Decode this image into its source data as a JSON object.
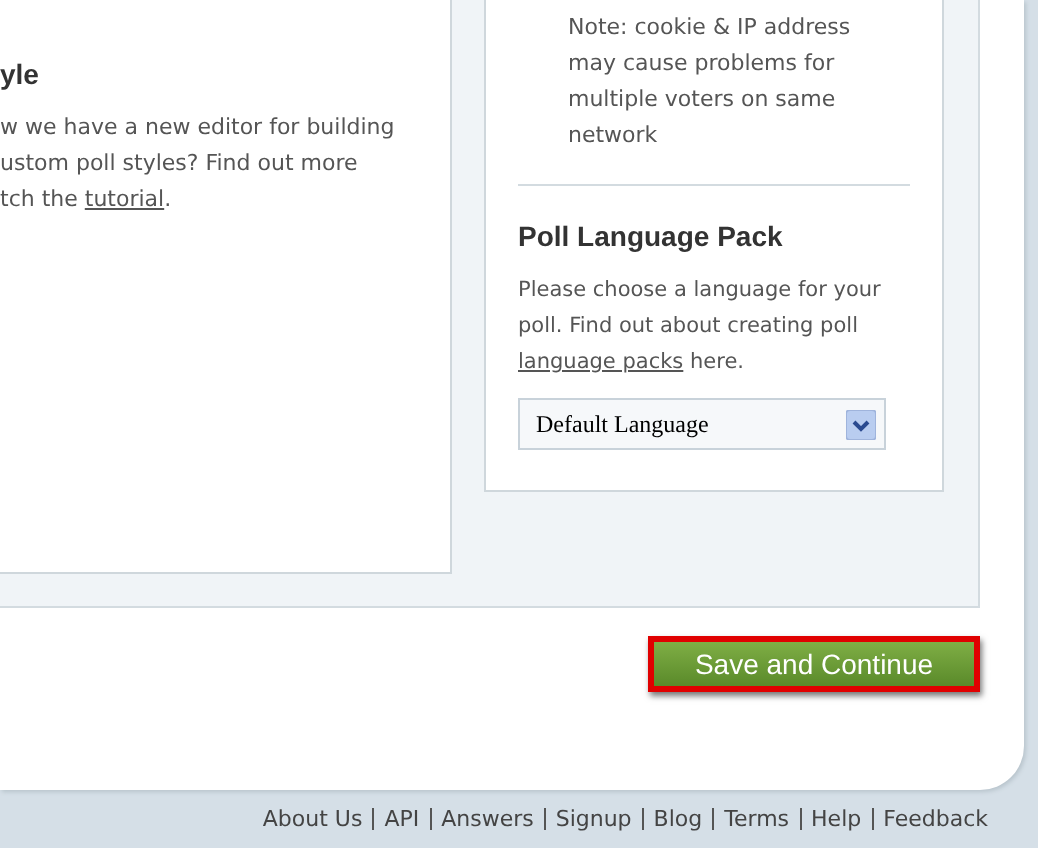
{
  "style_section": {
    "heading": "yle",
    "lines": [
      "w we have a new editor for building",
      "ustom poll styles? Find out more",
      "tch the "
    ],
    "link": "tutorial",
    "after_link": "."
  },
  "voting_note": {
    "lines": [
      "Note: cookie & IP address",
      "may cause problems for",
      "multiple voters on same",
      "network"
    ]
  },
  "language_pack": {
    "heading": "Poll Language Pack",
    "text_before": "Please choose a language for your poll. Find out about creating poll ",
    "link": "language packs",
    "text_after": " here.",
    "select": {
      "value": "Default Language"
    }
  },
  "save_button": {
    "label": "Save and Continue",
    "focused": true
  },
  "footer_links": [
    "About Us",
    "API",
    "Answers",
    "Signup",
    "Blog",
    "Terms",
    "Help",
    "Feedback"
  ]
}
